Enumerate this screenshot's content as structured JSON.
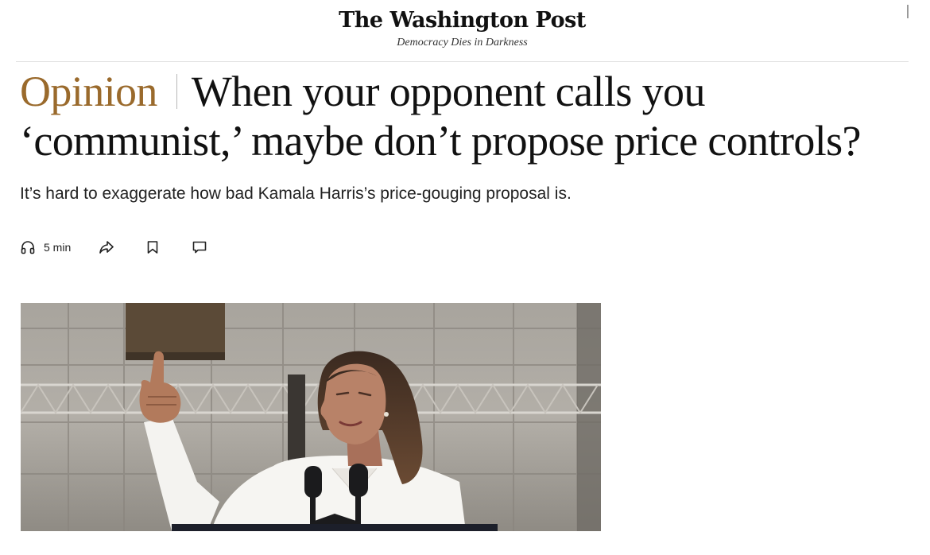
{
  "masthead": {
    "logo": "The Washington Post",
    "tagline": "Democracy Dies in Darkness"
  },
  "article": {
    "section_label": "Opinion",
    "headline_line1": "When your opponent calls you",
    "headline_line2": "‘communist,’ maybe don’t propose price controls?",
    "dek": "It’s hard to exaggerate how bad Kamala Harris’s price-gouging proposal is."
  },
  "actions": {
    "listen_icon": "headphones-icon",
    "listen_label": "5 min",
    "share_icon": "share-icon",
    "save_icon": "bookmark-icon",
    "comment_icon": "comment-icon"
  },
  "photo": {
    "subject": "speaker at podium"
  }
}
